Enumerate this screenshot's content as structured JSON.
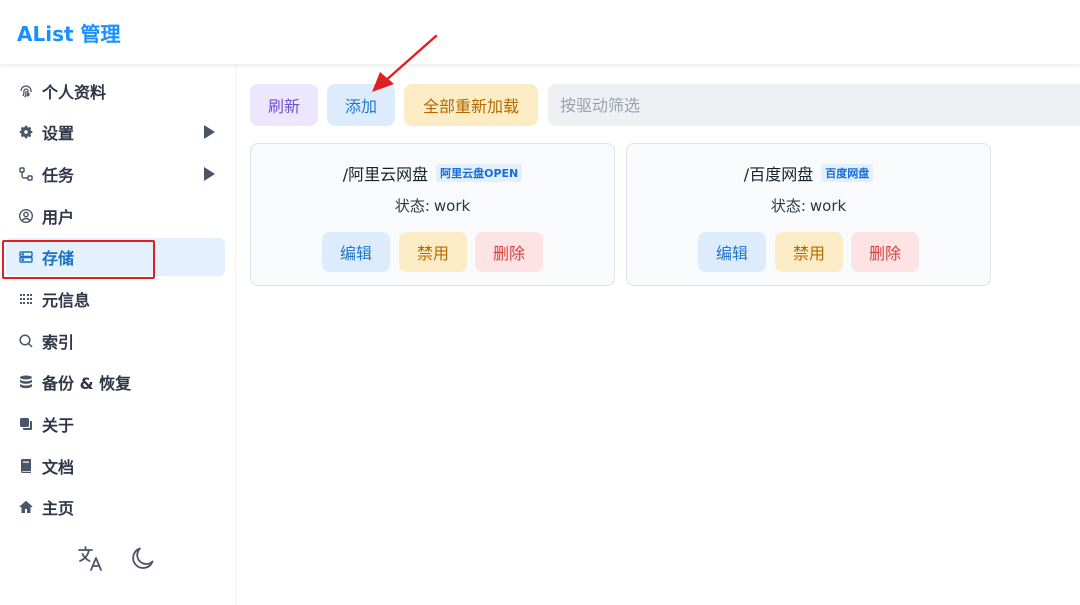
{
  "app": {
    "title": "AList 管理"
  },
  "sidebar": {
    "items": [
      {
        "label": "个人资料",
        "icon": "fingerprint-icon",
        "has_arrow": false
      },
      {
        "label": "设置",
        "icon": "gear-icon",
        "has_arrow": true
      },
      {
        "label": "任务",
        "icon": "flow-icon",
        "has_arrow": true
      },
      {
        "label": "用户",
        "icon": "user-circle-icon",
        "has_arrow": false
      },
      {
        "label": "存储",
        "icon": "database-icon",
        "has_arrow": false,
        "active": true
      },
      {
        "label": "元信息",
        "icon": "grid-icon",
        "has_arrow": false
      },
      {
        "label": "索引",
        "icon": "search-icon",
        "has_arrow": false
      },
      {
        "label": "备份 & 恢复",
        "icon": "stack-icon",
        "has_arrow": false
      },
      {
        "label": "关于",
        "icon": "copy-icon",
        "has_arrow": false
      },
      {
        "label": "文档",
        "icon": "book-icon",
        "has_arrow": false
      },
      {
        "label": "主页",
        "icon": "home-icon",
        "has_arrow": false
      }
    ],
    "bottom_icons": [
      "translate-icon",
      "moon-icon"
    ]
  },
  "toolbar": {
    "refresh_label": "刷新",
    "add_label": "添加",
    "reload_label": "全部重新加载",
    "filter_placeholder": "按驱动筛选"
  },
  "storages": [
    {
      "path": "/阿里云网盘",
      "driver": "阿里云盘OPEN",
      "status_label": "状态:",
      "status_value": "work",
      "edit_label": "编辑",
      "disable_label": "禁用",
      "delete_label": "删除"
    },
    {
      "path": "/百度网盘",
      "driver": "百度网盘",
      "status_label": "状态:",
      "status_value": "work",
      "edit_label": "编辑",
      "disable_label": "禁用",
      "delete_label": "删除"
    }
  ],
  "colors": {
    "brand": "#1890ff",
    "annotation": "#e02020",
    "active_bg": "#e3f0fd"
  }
}
